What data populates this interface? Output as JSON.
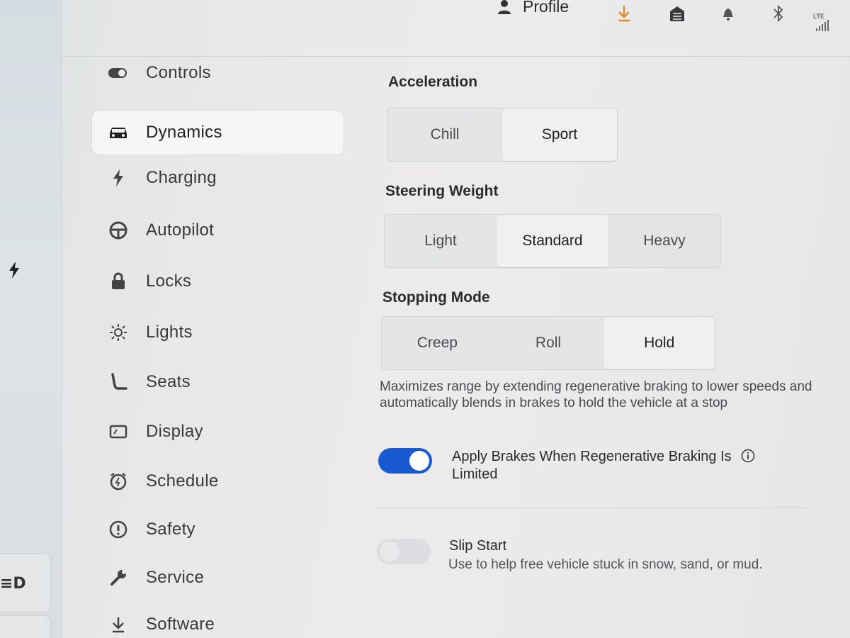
{
  "status_bar": {
    "profile_label": "Profile",
    "icons": [
      "person-icon",
      "download-icon",
      "garage-icon",
      "bell-icon",
      "bluetooth-icon",
      "lte-signal-icon"
    ],
    "lte_label": "LTE",
    "download_color": "#e08a2c"
  },
  "sidebar": {
    "items": [
      {
        "label": "Controls",
        "icon": "toggle-icon"
      },
      {
        "label": "Dynamics",
        "icon": "car-icon",
        "active": true
      },
      {
        "label": "Charging",
        "icon": "bolt-icon"
      },
      {
        "label": "Autopilot",
        "icon": "steering-wheel-icon"
      },
      {
        "label": "Locks",
        "icon": "lock-icon"
      },
      {
        "label": "Lights",
        "icon": "sun-icon"
      },
      {
        "label": "Seats",
        "icon": "seat-icon"
      },
      {
        "label": "Display",
        "icon": "display-icon"
      },
      {
        "label": "Schedule",
        "icon": "clock-icon"
      },
      {
        "label": "Safety",
        "icon": "alert-icon"
      },
      {
        "label": "Service",
        "icon": "wrench-icon"
      },
      {
        "label": "Software",
        "icon": "download-icon"
      }
    ]
  },
  "dynamics": {
    "acceleration": {
      "title": "Acceleration",
      "options": [
        "Chill",
        "Sport"
      ],
      "selected": "Sport"
    },
    "steering": {
      "title": "Steering Weight",
      "options": [
        "Light",
        "Standard",
        "Heavy"
      ],
      "selected": "Standard"
    },
    "stopping": {
      "title": "Stopping Mode",
      "options": [
        "Creep",
        "Roll",
        "Hold"
      ],
      "selected": "Hold"
    },
    "stopping_description": "Maximizes range by extending regenerative braking to lower speeds and automatically blends in brakes to hold the vehicle at a stop",
    "apply_brakes": {
      "label_line1": "Apply Brakes When Regenerative Braking Is",
      "label_line2": "Limited",
      "enabled": true
    },
    "slip_start": {
      "label": "Slip Start",
      "description": "Use to help free vehicle stuck in snow, sand, or mud.",
      "enabled": false
    }
  },
  "colors": {
    "accent": "#1a5ad0"
  }
}
